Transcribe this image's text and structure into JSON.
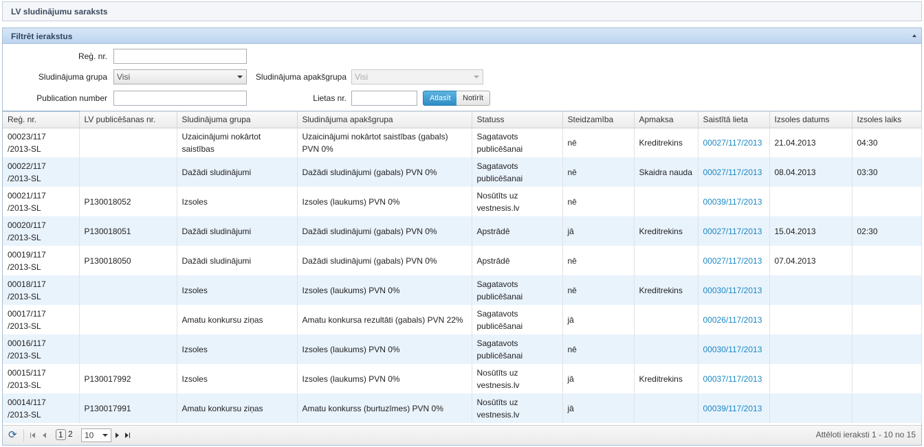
{
  "window": {
    "title": "LV sludinājumu saraksts"
  },
  "filter": {
    "title": "Filtrēt ierakstus",
    "reg_nr_label": "Reģ. nr.",
    "reg_nr_value": "",
    "group_label": "Sludinājuma grupa",
    "group_value": "Visi",
    "subgroup_label": "Sludinājuma apakšgrupa",
    "subgroup_value": "Visi",
    "pubnum_label": "Publication number",
    "pubnum_value": "",
    "case_label": "Lietas nr.",
    "case_value": "",
    "select_button": "Atlasīt",
    "clear_button": "Notīrīt"
  },
  "table": {
    "columns": [
      "Reģ. nr.",
      "LV publicēšanas nr.",
      "Sludinājuma grupa",
      "Sludinājuma apakšgrupa",
      "Statuss",
      "Steidzamība",
      "Apmaksa",
      "Saistītā lieta",
      "Izsoles datums",
      "Izsoles laiks"
    ],
    "rows": [
      {
        "reg": "00023/117\n/2013-SL",
        "pub": "",
        "group": "Uzaicinājumi nokārtot saistības",
        "subgroup": "Uzaicinājumi nokārtot saistības (gabals) PVN 0%",
        "status": "Sagatavots publicēšanai",
        "urgency": "nē",
        "payment": "Kreditrekins",
        "case": "00027/117/2013",
        "date": "21.04.2013",
        "time": "04:30"
      },
      {
        "reg": "00022/117\n/2013-SL",
        "pub": "",
        "group": "Dažādi sludinājumi",
        "subgroup": "Dažādi sludinājumi (gabals) PVN 0%",
        "status": "Sagatavots publicēšanai",
        "urgency": "nē",
        "payment": "Skaidra nauda",
        "case": "00027/117/2013",
        "date": "08.04.2013",
        "time": "03:30"
      },
      {
        "reg": "00021/117\n/2013-SL",
        "pub": "P130018052",
        "group": "Izsoles",
        "subgroup": "Izsoles (laukums) PVN 0%",
        "status": "Nosūtīts uz vestnesis.lv",
        "urgency": "nē",
        "payment": "",
        "case": "00039/117/2013",
        "date": "",
        "time": ""
      },
      {
        "reg": "00020/117\n/2013-SL",
        "pub": "P130018051",
        "group": "Dažādi sludinājumi",
        "subgroup": "Dažādi sludinājumi (gabals) PVN 0%",
        "status": "Apstrādē",
        "urgency": "jā",
        "payment": "Kreditrekins",
        "case": "00027/117/2013",
        "date": "15.04.2013",
        "time": "02:30"
      },
      {
        "reg": "00019/117\n/2013-SL",
        "pub": "P130018050",
        "group": "Dažādi sludinājumi",
        "subgroup": "Dažādi sludinājumi (gabals) PVN 0%",
        "status": "Apstrādē",
        "urgency": "nē",
        "payment": "",
        "case": "00027/117/2013",
        "date": "07.04.2013",
        "time": ""
      },
      {
        "reg": "00018/117\n/2013-SL",
        "pub": "",
        "group": "Izsoles",
        "subgroup": "Izsoles (laukums) PVN 0%",
        "status": "Sagatavots publicēšanai",
        "urgency": "nē",
        "payment": "Kreditrekins",
        "case": "00030/117/2013",
        "date": "",
        "time": ""
      },
      {
        "reg": "00017/117\n/2013-SL",
        "pub": "",
        "group": "Amatu konkursu ziņas",
        "subgroup": "Amatu konkursa rezultāti (gabals) PVN 22%",
        "status": "Sagatavots publicēšanai",
        "urgency": "jā",
        "payment": "",
        "case": "00026/117/2013",
        "date": "",
        "time": ""
      },
      {
        "reg": "00016/117\n/2013-SL",
        "pub": "",
        "group": "Izsoles",
        "subgroup": "Izsoles (laukums) PVN 0%",
        "status": "Sagatavots publicēšanai",
        "urgency": "nē",
        "payment": "",
        "case": "00030/117/2013",
        "date": "",
        "time": ""
      },
      {
        "reg": "00015/117\n/2013-SL",
        "pub": "P130017992",
        "group": "Izsoles",
        "subgroup": "Izsoles (laukums) PVN 0%",
        "status": "Nosūtīts uz vestnesis.lv",
        "urgency": "jā",
        "payment": "Kreditrekins",
        "case": "00037/117/2013",
        "date": "",
        "time": ""
      },
      {
        "reg": "00014/117\n/2013-SL",
        "pub": "P130017991",
        "group": "Amatu konkursu ziņas",
        "subgroup": "Amatu konkurss (burtuzīmes) PVN 0%",
        "status": "Nosūtīts uz vestnesis.lv",
        "urgency": "jā",
        "payment": "",
        "case": "00039/117/2013",
        "date": "",
        "time": ""
      }
    ]
  },
  "pager": {
    "pages": [
      "1",
      "2"
    ],
    "current_page": "1",
    "page_size": "10",
    "summary": "Attēloti ieraksti 1 - 10 no 15"
  },
  "colors": {
    "accent": "#1a87c3",
    "header": "#bdd5ef",
    "row_alt": "#e9f3fc"
  }
}
